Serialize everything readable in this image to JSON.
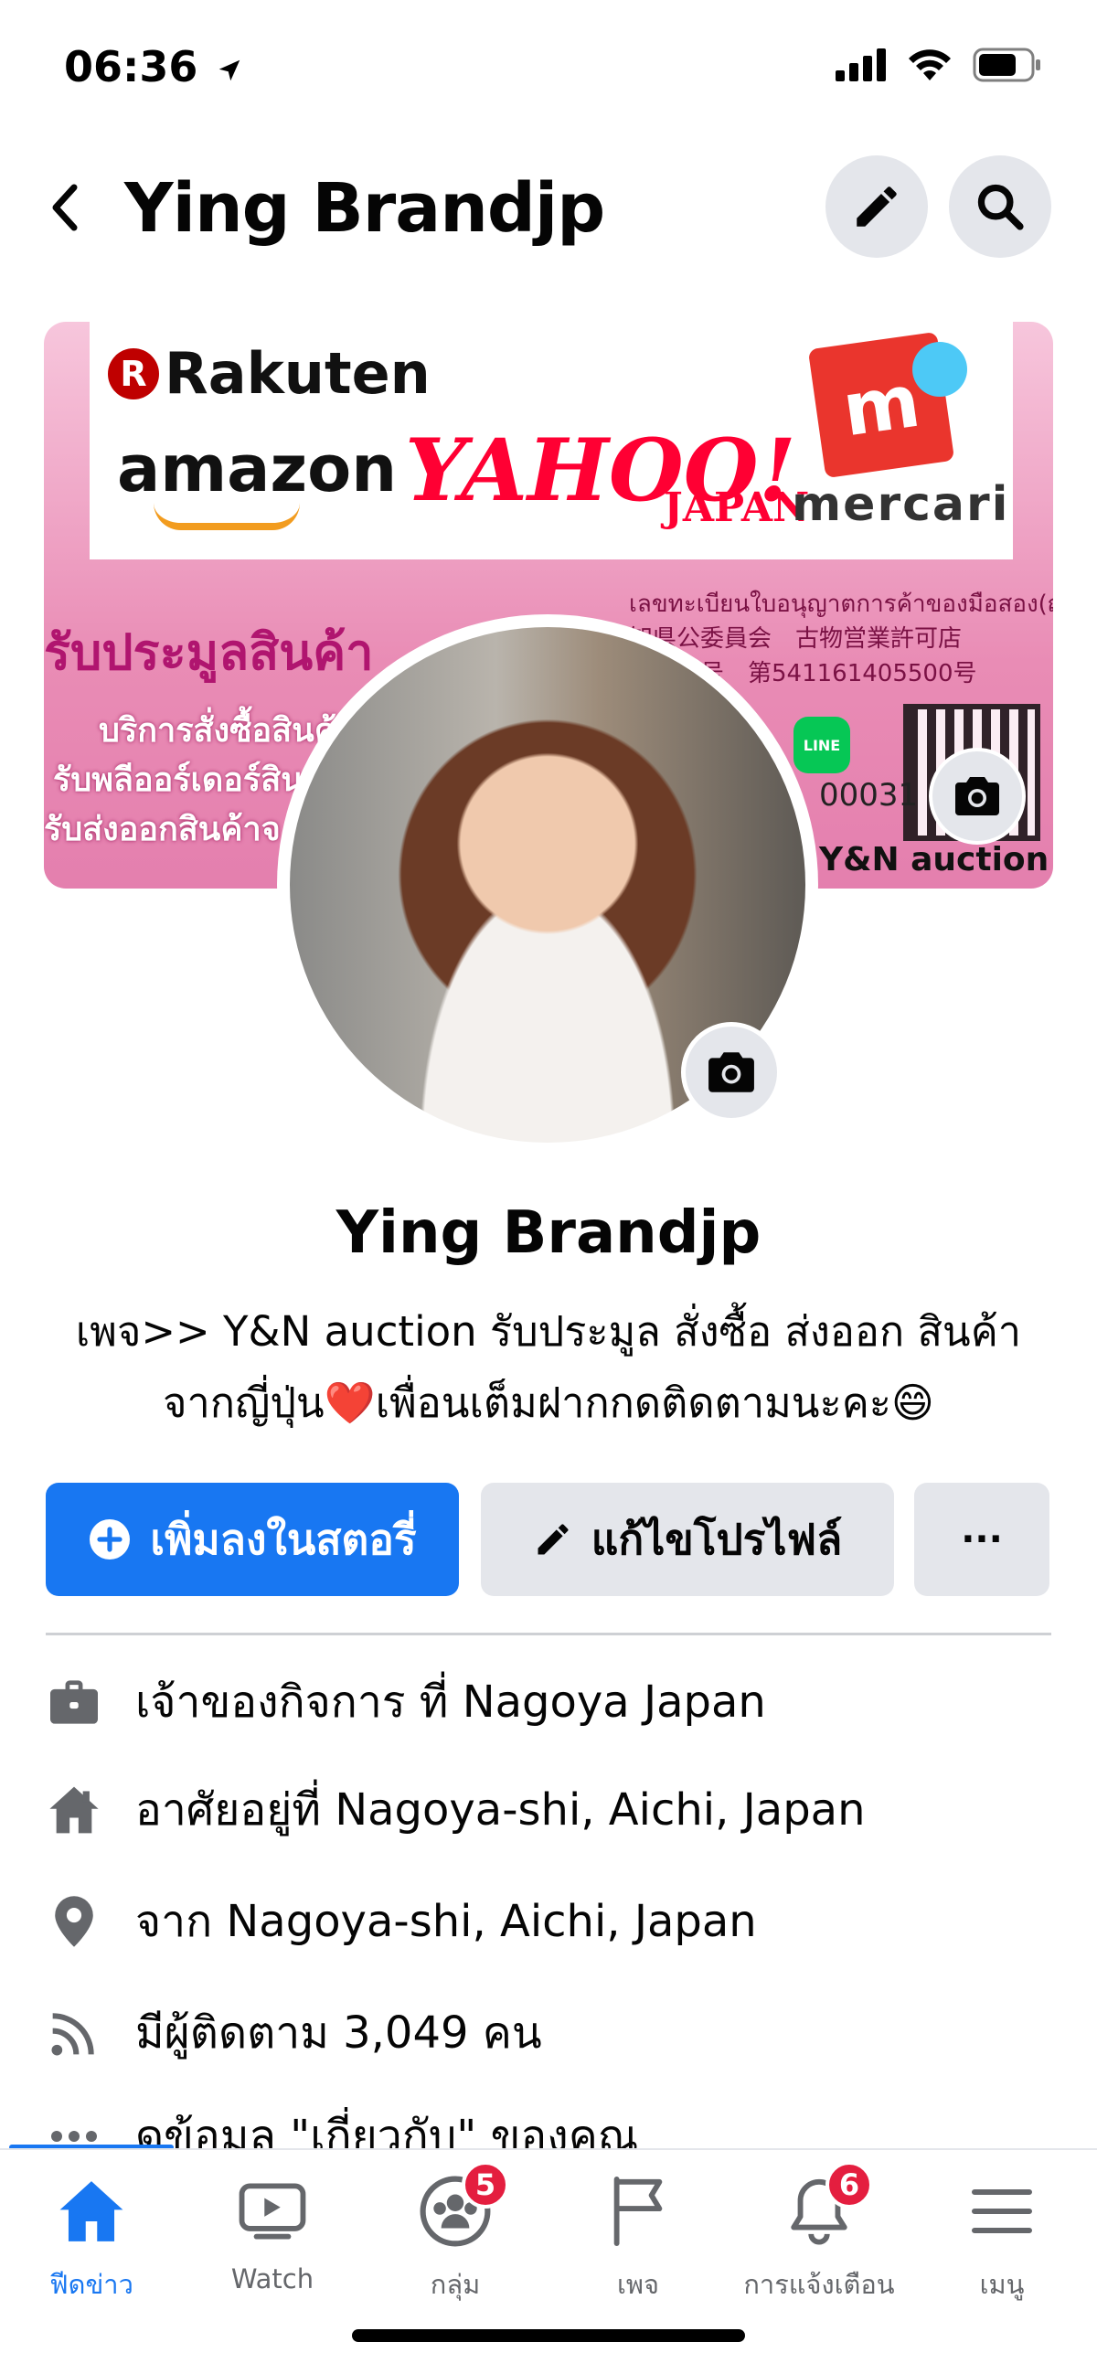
{
  "status_bar": {
    "time": "06:36",
    "location_icon": "location-arrow-icon",
    "signal_icon": "cellular-signal-icon",
    "wifi_icon": "wifi-icon",
    "battery_icon": "battery-icon"
  },
  "header": {
    "title": "Ying Brandjp",
    "back_icon": "back-chevron-icon",
    "edit_icon": "pencil-icon",
    "search_icon": "search-icon"
  },
  "cover": {
    "logos": {
      "rakuten": "Rakuten",
      "rakuten_mark": "R",
      "amazon": "amazon",
      "yahoo": "YAHOO!",
      "yahoo_sub": "JAPAN",
      "mercari": "mercari",
      "mercari_mark": "m"
    },
    "headline": "รับประมูลสินค้า",
    "lines": [
      "บริการสั่งซื้อสินค้",
      "รับพลีออร์เดอร์สิน",
      "รับส่งออกสินค้าจ"
    ],
    "license": [
      "เลขทะเบียนใบอนุญาตการค้าของมือสอง(ญี่ปุ่น)",
      "知県公委員会　古物営業許可店",
      "許可番号　第541161405500号"
    ],
    "line_label": "LINE",
    "phone_partial": "00031",
    "brand": "Y&N auction",
    "camera_icon": "camera-icon"
  },
  "profile": {
    "name": "Ying Brandjp",
    "bio_line1": "เพจ>> Y&N auction รับประมูล สั่งซื้อ ส่งออก สินค้า",
    "bio_line2": "จากญี่ปุ่น❤️เพื่อนเต็มฝากกดติดตามนะคะ😄",
    "avatar_camera_icon": "camera-icon"
  },
  "actions": {
    "add_story": "เพิ่มลงในสตอรี่",
    "edit_profile": "แก้ไขโปรไฟล์",
    "more": "···"
  },
  "details": [
    {
      "icon": "briefcase-icon",
      "text": "เจ้าของกิจการ ที่ Nagoya Japan"
    },
    {
      "icon": "home-icon",
      "text": "อาศัยอยู่ที่ Nagoya-shi, Aichi, Japan"
    },
    {
      "icon": "location-pin-icon",
      "text": "จาก Nagoya-shi, Aichi, Japan"
    },
    {
      "icon": "rss-followers-icon",
      "text": "มีผู้ติดตาม 3,049 คน"
    },
    {
      "icon": "more-dots-icon",
      "text": "ดูข้อมูล \"เกี่ยวกับ\" ของคุณ"
    }
  ],
  "nav": [
    {
      "label": "ฟีดข่าว",
      "icon": "home-icon",
      "active": true
    },
    {
      "label": "Watch",
      "icon": "watch-video-icon"
    },
    {
      "label": "กลุ่ม",
      "icon": "groups-icon",
      "badge": "5"
    },
    {
      "label": "เพจ",
      "icon": "flag-icon"
    },
    {
      "label": "การแจ้งเตือน",
      "icon": "bell-icon",
      "badge": "6"
    },
    {
      "label": "เมนู",
      "icon": "hamburger-menu-icon"
    }
  ],
  "colors": {
    "accent": "#1877f2",
    "badge": "#e41e3f",
    "secondary_button": "#e4e6eb",
    "cover_pink": "#e98cb5"
  }
}
